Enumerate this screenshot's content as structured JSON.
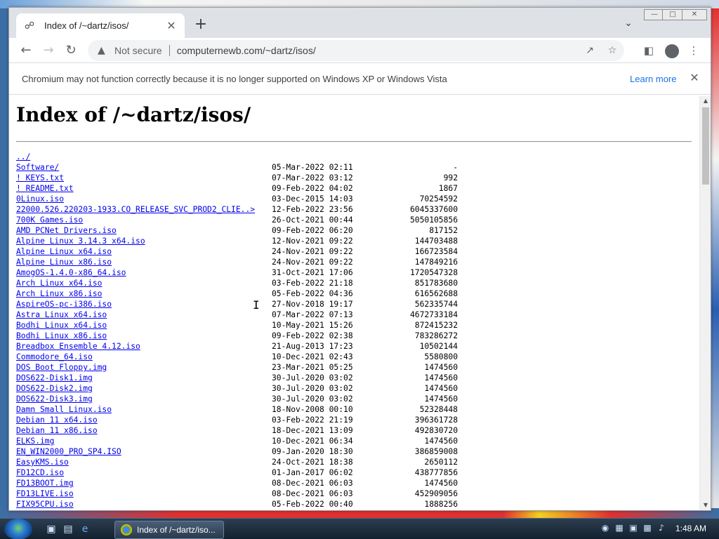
{
  "browser": {
    "tab_title": "Index of /~dartz/isos/",
    "not_secure_label": "Not secure",
    "url": "computernewb.com/~dartz/isos/",
    "infobar_text": "Chromium may not function correctly because it is no longer supported on Windows XP or Windows Vista",
    "infobar_link": "Learn more"
  },
  "page": {
    "title": "Index of /~dartz/isos/",
    "parent_link": "../",
    "entries": [
      {
        "name": "Software/",
        "date": "05-Mar-2022 02:11",
        "size": "-"
      },
      {
        "name": "! KEYS.txt",
        "date": "07-Mar-2022 03:12",
        "size": "992"
      },
      {
        "name": "! README.txt",
        "date": "09-Feb-2022 04:02",
        "size": "1867"
      },
      {
        "name": "0Linux.iso",
        "date": "03-Dec-2015 14:03",
        "size": "70254592"
      },
      {
        "name": "22000.526.220203-1933.CO_RELEASE_SVC_PROD2_CLIE..>",
        "date": "12-Feb-2022 23:56",
        "size": "6045337600"
      },
      {
        "name": "700K Games.iso",
        "date": "26-Oct-2021 00:44",
        "size": "5050105856"
      },
      {
        "name": "AMD PCNet Drivers.iso",
        "date": "09-Feb-2022 06:20",
        "size": "817152"
      },
      {
        "name": "Alpine Linux 3.14.3 x64.iso",
        "date": "12-Nov-2021 09:22",
        "size": "144703488"
      },
      {
        "name": "Alpine Linux x64.iso",
        "date": "24-Nov-2021 09:22",
        "size": "166723584"
      },
      {
        "name": "Alpine Linux x86.iso",
        "date": "24-Nov-2021 09:22",
        "size": "147849216"
      },
      {
        "name": "AmogOS-1.4.0-x86_64.iso",
        "date": "31-Oct-2021 17:06",
        "size": "1720547328"
      },
      {
        "name": "Arch Linux x64.iso",
        "date": "03-Feb-2022 21:18",
        "size": "851783680"
      },
      {
        "name": "Arch Linux x86.iso",
        "date": "05-Feb-2022 04:36",
        "size": "616562688"
      },
      {
        "name": "AspireOS-pc-i386.iso",
        "date": "27-Nov-2018 19:17",
        "size": "562335744"
      },
      {
        "name": "Astra Linux x64.iso",
        "date": "07-Mar-2022 07:13",
        "size": "4672733184"
      },
      {
        "name": "Bodhi Linux x64.iso",
        "date": "10-May-2021 15:26",
        "size": "872415232"
      },
      {
        "name": "Bodhi Linux x86.iso",
        "date": "09-Feb-2022 02:38",
        "size": "783286272"
      },
      {
        "name": "Breadbox Ensemble 4.12.iso",
        "date": "21-Aug-2013 17:23",
        "size": "10502144"
      },
      {
        "name": "Commodore_64.iso",
        "date": "10-Dec-2021 02:43",
        "size": "5580800"
      },
      {
        "name": "DOS Boot Floppy.img",
        "date": "23-Mar-2021 05:25",
        "size": "1474560"
      },
      {
        "name": "DOS622-Disk1.img",
        "date": "30-Jul-2020 03:02",
        "size": "1474560"
      },
      {
        "name": "DOS622-Disk2.img",
        "date": "30-Jul-2020 03:02",
        "size": "1474560"
      },
      {
        "name": "DOS622-Disk3.img",
        "date": "30-Jul-2020 03:02",
        "size": "1474560"
      },
      {
        "name": "Damn Small Linux.iso",
        "date": "18-Nov-2008 00:10",
        "size": "52328448"
      },
      {
        "name": "Debian 11 x64.iso",
        "date": "03-Feb-2022 21:19",
        "size": "396361728"
      },
      {
        "name": "Debian 11 x86.iso",
        "date": "18-Dec-2021 13:09",
        "size": "492830720"
      },
      {
        "name": "ELKS.img",
        "date": "10-Dec-2021 06:34",
        "size": "1474560"
      },
      {
        "name": "EN_WIN2000_PRO_SP4.ISO",
        "date": "09-Jan-2020 18:30",
        "size": "386859008"
      },
      {
        "name": "EasyKMS.iso",
        "date": "24-Oct-2021 18:38",
        "size": "2650112"
      },
      {
        "name": "FD12CD.iso",
        "date": "01-Jan-2017 06:02",
        "size": "438777856"
      },
      {
        "name": "FD13BOOT.img",
        "date": "08-Dec-2021 06:03",
        "size": "1474560"
      },
      {
        "name": "FD13LIVE.iso",
        "date": "08-Dec-2021 06:03",
        "size": "452909056"
      },
      {
        "name": "FIX95CPU.iso",
        "date": "05-Feb-2022 00:40",
        "size": "1888256"
      }
    ]
  },
  "taskbar": {
    "window_button": "Index of /~dartz/iso...",
    "clock": "1:48 AM"
  },
  "colors": {
    "link": "#0000ee",
    "accent": "#1a73e8"
  }
}
